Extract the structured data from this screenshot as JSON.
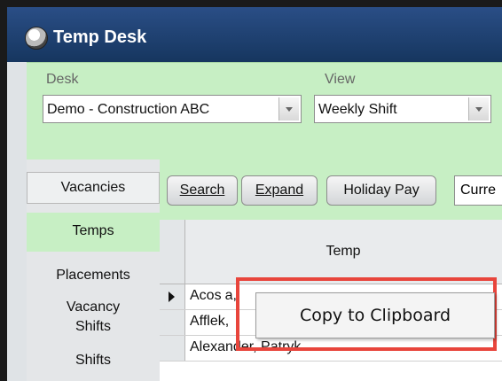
{
  "window": {
    "title": "Temp Desk",
    "icon": "temp-desk-app-icon"
  },
  "filters": {
    "desk": {
      "label": "Desk",
      "value": "Demo - Construction ABC"
    },
    "view": {
      "label": "View",
      "value": "Weekly Shift"
    }
  },
  "sidebar": {
    "items": [
      {
        "label": "Vacancies"
      },
      {
        "label": "Temps",
        "active": true
      },
      {
        "label": "Placements"
      },
      {
        "label": "Vacancy"
      },
      {
        "label": "Shifts"
      },
      {
        "label": "Shifts"
      }
    ]
  },
  "toolbar": {
    "search_label": "Search",
    "expand_label": "Expand",
    "holiday_pay_label": "Holiday Pay",
    "current_select_visible": "Curre"
  },
  "grid": {
    "column_header": "Temp",
    "rows": [
      {
        "name_visible": "Acos",
        "suffix_visible": "a,",
        "selected": true
      },
      {
        "name_visible": "Affle",
        "suffix_visible": "k,"
      },
      {
        "name_visible": "Alexander, Patryk"
      }
    ]
  },
  "context_menu": {
    "item": "Copy to Clipboard"
  },
  "colors": {
    "panel_green": "#c7efc4",
    "title_blue": "#1f4271",
    "highlight_red": "#e8453c"
  }
}
